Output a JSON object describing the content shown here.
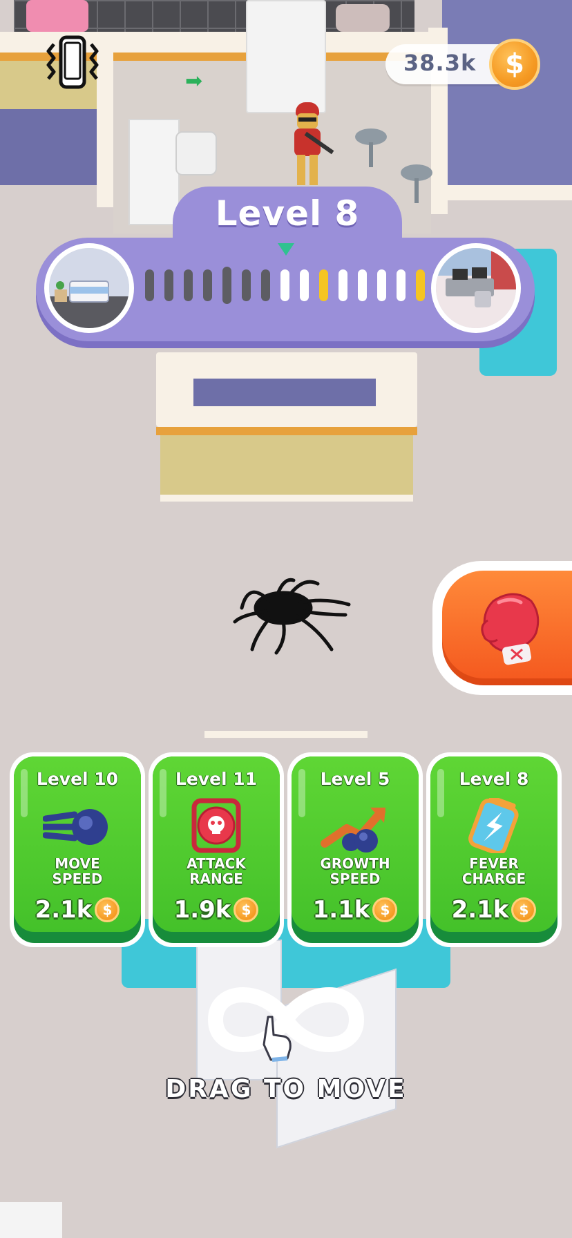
{
  "hud": {
    "coins": "38.3k",
    "coin_symbol": "$",
    "vibration_icon": "phone-vibrate-icon"
  },
  "level_progress": {
    "title": "Level 8",
    "current_room_icon": "hospital-room-icon",
    "next_room_icon": "office-room-icon",
    "stages": [
      "done",
      "done",
      "done",
      "done",
      "done",
      "done",
      "done",
      "todo",
      "todo",
      "milestone",
      "todo",
      "todo",
      "todo",
      "todo",
      "milestone"
    ],
    "colors": {
      "done": "#5d5d63",
      "todo": "#ffffff",
      "milestone": "#f5c522",
      "panel": "#9a8fd9"
    }
  },
  "boost": {
    "icon": "boxing-glove-icon"
  },
  "upgrades": [
    {
      "level": "Level 10",
      "name": "MOVE\nSPEED",
      "price": "2.1k",
      "icon": "speed-blob-icon"
    },
    {
      "level": "Level 11",
      "name": "ATTACK\nRANGE",
      "price": "1.9k",
      "icon": "target-skull-icon"
    },
    {
      "level": "Level 5",
      "name": "GROWTH\nSPEED",
      "price": "1.1k",
      "icon": "growth-arrow-icon"
    },
    {
      "level": "Level 8",
      "name": "FEVER\nCHARGE",
      "price": "2.1k",
      "icon": "battery-charge-icon"
    }
  ],
  "coin_symbol_small": "$",
  "hint": {
    "text": "DRAG TO MOVE",
    "icon": "infinity-drag-hand-icon"
  }
}
